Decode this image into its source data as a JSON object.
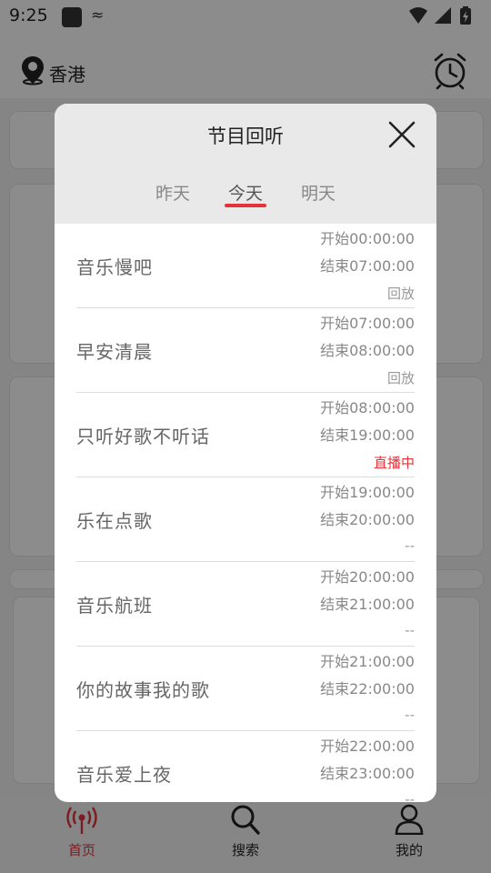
{
  "status_bar": {
    "time": "9:25",
    "extra": "≈"
  },
  "header": {
    "location": "香港"
  },
  "modal": {
    "title": "节目回听",
    "tabs": [
      {
        "label": "昨天"
      },
      {
        "label": "今天"
      },
      {
        "label": "明天"
      }
    ],
    "active_tab": "今天",
    "programs": [
      {
        "name": "音乐慢吧",
        "start": "开始00:00:00",
        "end": "结束07:00:00",
        "status": "回放"
      },
      {
        "name": "早安清晨",
        "start": "开始07:00:00",
        "end": "结束08:00:00",
        "status": "回放"
      },
      {
        "name": "只听好歌不听话",
        "start": "开始08:00:00",
        "end": "结束19:00:00",
        "status": "直播中"
      },
      {
        "name": "乐在点歌",
        "start": "开始19:00:00",
        "end": "结束20:00:00",
        "status": "--"
      },
      {
        "name": "音乐航班",
        "start": "开始20:00:00",
        "end": "结束21:00:00",
        "status": "--"
      },
      {
        "name": "你的故事我的歌",
        "start": "开始21:00:00",
        "end": "结束22:00:00",
        "status": "--"
      },
      {
        "name": "音乐爱上夜",
        "start": "开始22:00:00",
        "end": "结束23:00:00",
        "status": "--"
      }
    ]
  },
  "bottom_nav": {
    "items": [
      {
        "label": "首页"
      },
      {
        "label": "搜索"
      },
      {
        "label": "我的"
      }
    ]
  },
  "colors": {
    "accent": "#e4333b",
    "overlay": "rgba(0,0,0,0.45)"
  }
}
